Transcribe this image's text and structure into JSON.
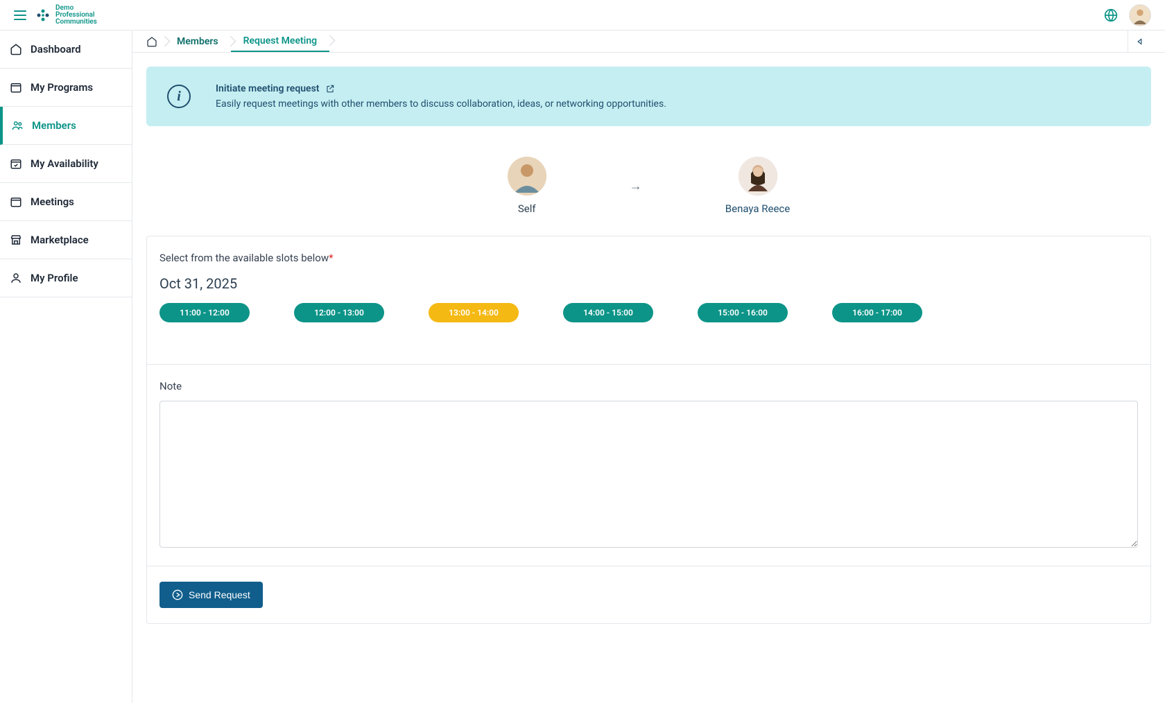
{
  "brand": {
    "line1": "Demo",
    "line2": "Professional",
    "line3": "Communities"
  },
  "sidebar": {
    "items": [
      {
        "label": "Dashboard",
        "icon": "home"
      },
      {
        "label": "My Programs",
        "icon": "calendar"
      },
      {
        "label": "Members",
        "icon": "users",
        "active": true
      },
      {
        "label": "My Availability",
        "icon": "calendar-check"
      },
      {
        "label": "Meetings",
        "icon": "calendar"
      },
      {
        "label": "Marketplace",
        "icon": "store"
      },
      {
        "label": "My Profile",
        "icon": "user"
      }
    ]
  },
  "breadcrumb": {
    "members_label": "Members",
    "request_label": "Request Meeting"
  },
  "info": {
    "title": "Initiate meeting request",
    "desc": "Easily request meetings with other members to discuss collaboration, ideas, or networking opportunities."
  },
  "participants": {
    "self_label": "Self",
    "other_label": "Benaya Reece"
  },
  "selectSlots": {
    "label": "Select from the available slots below",
    "date": "Oct 31, 2025",
    "slots": [
      {
        "label": "11:00 - 12:00",
        "selected": false
      },
      {
        "label": "12:00 - 13:00",
        "selected": false
      },
      {
        "label": "13:00 - 14:00",
        "selected": true
      },
      {
        "label": "14:00 - 15:00",
        "selected": false
      },
      {
        "label": "15:00 - 16:00",
        "selected": false
      },
      {
        "label": "16:00 - 17:00",
        "selected": false
      }
    ]
  },
  "note_label": "Note",
  "send_label": "Send Request"
}
